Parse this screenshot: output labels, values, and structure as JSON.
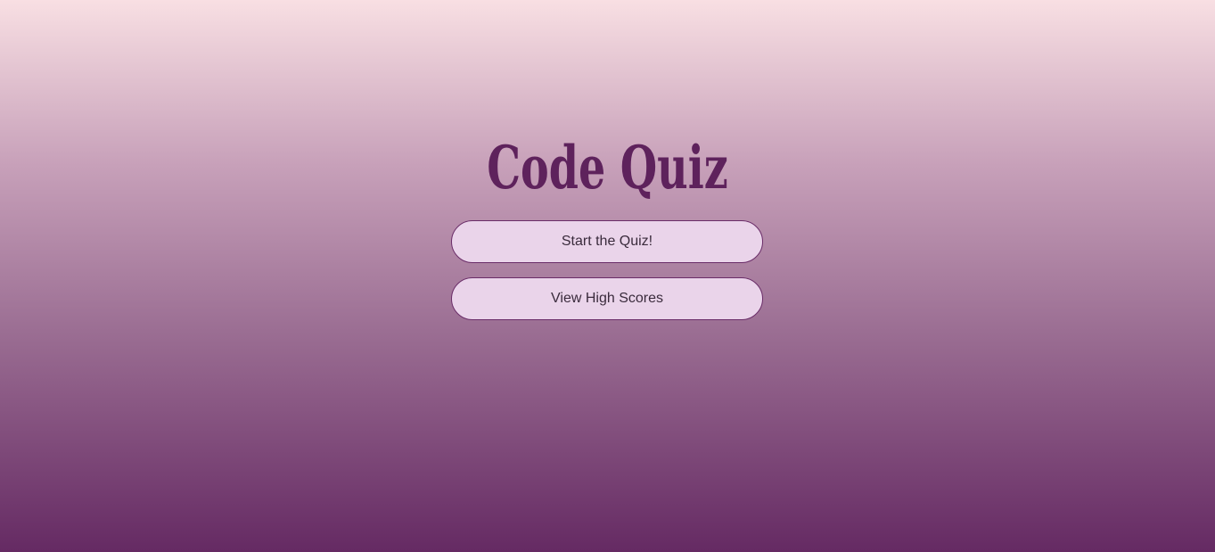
{
  "page": {
    "title": "Code Quiz"
  },
  "buttons": {
    "start_label": "Start the Quiz!",
    "scores_label": "View High Scores"
  },
  "colors": {
    "title": "#5e225c",
    "button_bg": "#ead4ea",
    "button_border": "#6a2c68",
    "background_top": "#f8dfe3",
    "background_bottom": "#652a63"
  }
}
